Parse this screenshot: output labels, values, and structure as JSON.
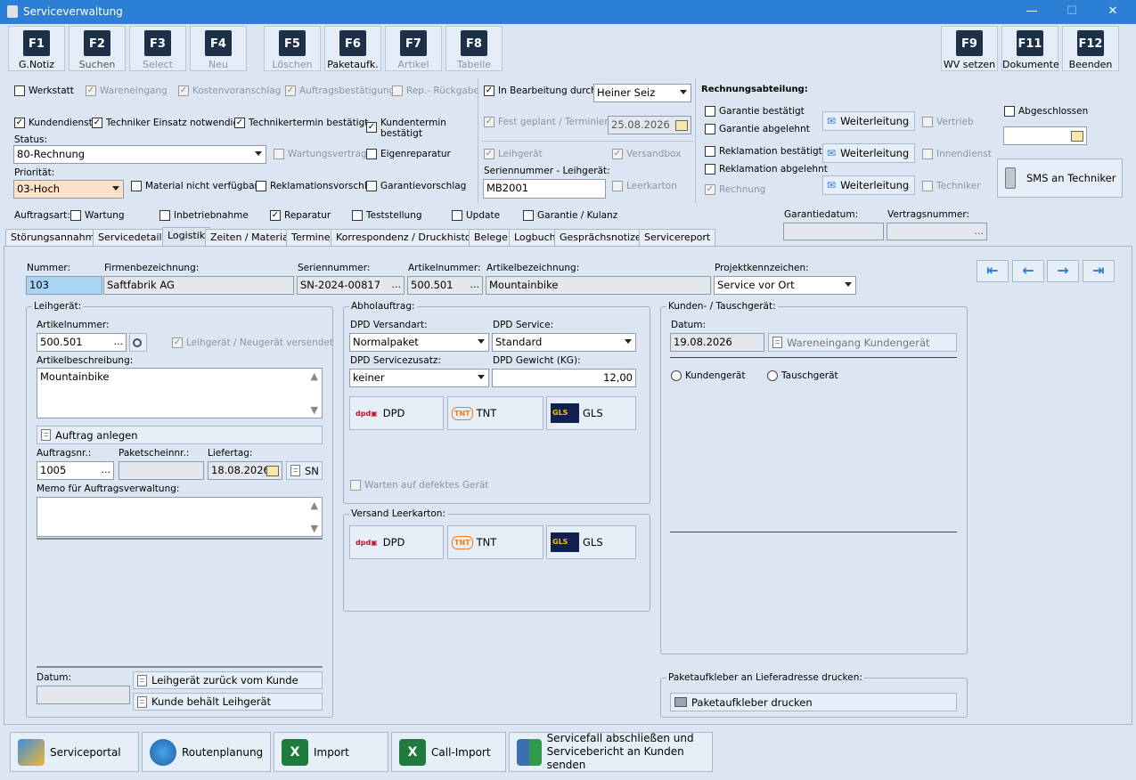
{
  "window": {
    "title": "Serviceverwaltung",
    "min": "—",
    "max": "☐",
    "close": "✕"
  },
  "fkeys": [
    {
      "k": "F1",
      "l": "G.Notiz"
    },
    {
      "k": "F2",
      "l": "Suchen"
    },
    {
      "k": "F3",
      "l": "Select"
    },
    {
      "k": "F4",
      "l": "Neu"
    },
    {
      "k": "F5",
      "l": "Löschen"
    },
    {
      "k": "F6",
      "l": "Paketaufk."
    },
    {
      "k": "F7",
      "l": "Artikel"
    },
    {
      "k": "F8",
      "l": "Tabelle"
    },
    {
      "k": "F9",
      "l": "WV setzen"
    },
    {
      "k": "F11",
      "l": "Dokumente"
    },
    {
      "k": "F12",
      "l": "Beenden"
    }
  ],
  "top": {
    "werkstatt": "Werkstatt",
    "wareneingang": "Wareneingang",
    "kostenvoranschlag": "Kostenvoranschlag",
    "auftragsbestaetigung": "Auftragsbestätigung",
    "rep_rueckgabe": "Rep.- Rückgabe",
    "kundendienst": "Kundendienst",
    "techniker_einsatz": "Techniker Einsatz notwendig",
    "technikertermin": "Technikertermin bestätigt",
    "kundentermin": "Kundentermin bestätigt",
    "status_label": "Status:",
    "status_value": "80-Rechnung",
    "wartungsvertrag": "Wartungsvertrag",
    "eigenreparatur": "Eigenreparatur",
    "prioritaet_label": "Priorität:",
    "prioritaet_value": "03-Hoch",
    "material": "Material nicht verfügbar",
    "reklamationsvorschl": "Reklamationsvorschl.",
    "garantievorschlag": "Garantievorschlag",
    "in_bearbeitung": "In Bearbeitung durch:",
    "bearbeiter": "Heiner Seiz",
    "fest_geplant": "Fest geplant / Terminiert",
    "termin_datum": "25.08.2026",
    "leihgeraet": "Leihgerät",
    "versandbox": "Versandbox",
    "seriennummer_leih_label": "Seriennummer - Leihgerät:",
    "seriennummer_leih": "MB2001",
    "leerkarton": "Leerkarton",
    "rechnungsabteilung": "Rechnungsabteilung:",
    "garantie_bestaetigt": "Garantie bestätigt",
    "garantie_abgelehnt": "Garantie abgelehnt",
    "reklamation_bestaetigt": "Reklamation bestätigt",
    "reklamation_abgelehnt": "Reklamation abgelehnt",
    "rechnung": "Rechnung",
    "weiterleitung": "Weiterleitung",
    "vertrieb": "Vertrieb",
    "innendienst": "Innendienst",
    "techniker": "Techniker",
    "abgeschlossen": "Abgeschlossen",
    "sms": "SMS an Techniker"
  },
  "auftragsart": {
    "label": "Auftragsart:",
    "wartung": "Wartung",
    "inbetriebnahme": "Inbetriebnahme",
    "reparatur": "Reparatur",
    "teststellung": "Teststellung",
    "update": "Update",
    "garantie": "Garantie / Kulanz",
    "garantiedatum": "Garantiedatum:",
    "vertragsnummer": "Vertragsnummer:",
    "dots": "..."
  },
  "tabs": [
    "Störungsannahme",
    "Servicedetails",
    "Logistik",
    "Zeiten / Material",
    "Termine",
    "Korrespondenz / Druckhistorie",
    "Belege",
    "Logbuch",
    "Gesprächsnotizen",
    "Servicereport"
  ],
  "header": {
    "nummer_l": "Nummer:",
    "nummer": "103",
    "firma_l": "Firmenbezeichnung:",
    "firma": "Saftfabrik AG",
    "sn_l": "Seriennummer:",
    "sn": "SN-2024-00817",
    "artnr_l": "Artikelnummer:",
    "artnr": "500.501",
    "artbez_l": "Artikelbezeichnung:",
    "artbez": "Mountainbike",
    "projekt_l": "Projektkennzeichen:",
    "projekt": "Service vor Ort"
  },
  "leih": {
    "title": "Leihgerät:",
    "artnr_l": "Artikelnummer:",
    "artnr": "500.501",
    "versendet": "Leihgerät / Neugerät versendet",
    "artbez_l": "Artikelbeschreibung:",
    "artbez": "Mountainbike",
    "auftrag_anlegen": "Auftrag anlegen",
    "auftragsnr_l": "Auftragsnr.:",
    "auftragsnr": "1005",
    "paketschein_l": "Paketscheinnr.:",
    "liefertag_l": "Liefertag:",
    "liefertag": "18.08.2026",
    "sn": "SN",
    "memo_l": "Memo für Auftragsverwaltung:",
    "datum_l": "Datum:",
    "zurueck": "Leihgerät zurück vom Kunde",
    "behaelt": "Kunde behält Leihgerät"
  },
  "abhol": {
    "title": "Abholauftrag:",
    "versandart_l": "DPD Versandart:",
    "versandart": "Normalpaket",
    "service_l": "DPD Service:",
    "service": "Standard",
    "zusatz_l": "DPD Servicezusatz:",
    "zusatz": "keiner",
    "gewicht_l": "DPD Gewicht (KG):",
    "gewicht": "12,00",
    "dpd": "DPD",
    "tnt": "TNT",
    "gls": "GLS",
    "warten": "Warten auf defektes Gerät"
  },
  "leer": {
    "title": "Versand Leerkarton:",
    "dpd": "DPD",
    "tnt": "TNT",
    "gls": "GLS"
  },
  "kunden": {
    "title": "Kunden- / Tauschgerät:",
    "datum_l": "Datum:",
    "datum": "19.08.2026",
    "wareneingang": "Wareneingang Kundengerät",
    "kundengeraet": "Kundengerät",
    "tauschgeraet": "Tauschgerät"
  },
  "paket": {
    "title": "Paketaufkleber an Lieferadresse drucken:",
    "button": "Paketaufkleber drucken"
  },
  "bottom": {
    "serviceportal": "Serviceportal",
    "routenplanung": "Routenplanung",
    "import": "Import",
    "callimport": "Call-Import",
    "abschliessen1": "Servicefall abschließen und",
    "abschliessen2": "Servicebericht an Kunden senden"
  }
}
